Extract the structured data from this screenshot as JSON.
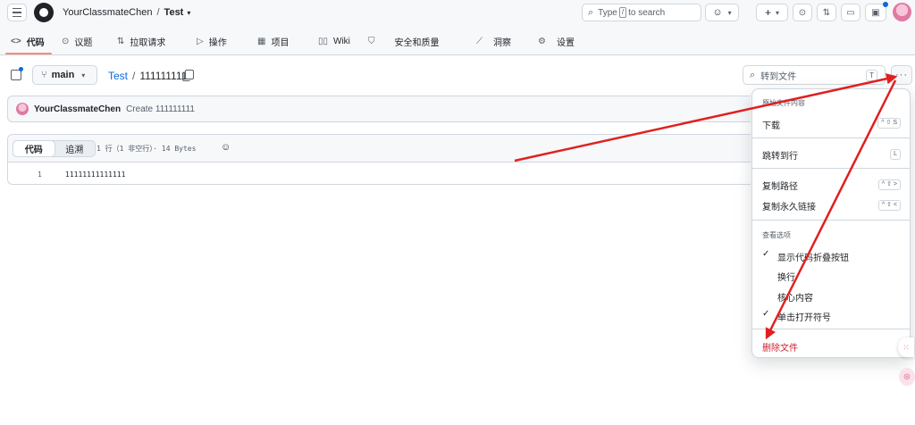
{
  "header": {
    "owner": "YourClassmateChen",
    "separator": "/",
    "repo": "Test",
    "search_prefix": "Type",
    "search_key": "/",
    "search_suffix": "to search",
    "plus": "+",
    "caret": "▾"
  },
  "tabs": [
    {
      "icon": "<>",
      "label": "代码"
    },
    {
      "icon": "⊙",
      "label": "议题"
    },
    {
      "icon": "⇅",
      "label": "拉取请求"
    },
    {
      "icon": "▷",
      "label": "操作"
    },
    {
      "icon": "▦",
      "label": "项目"
    },
    {
      "icon": "▯▯",
      "label": "Wiki"
    },
    {
      "icon": "⛉",
      "label": "安全和质量"
    },
    {
      "icon": "⟋",
      "label": "洞察"
    },
    {
      "icon": "⚙",
      "label": "设置"
    }
  ],
  "toolbar": {
    "branch": "main",
    "path_repo": "Test",
    "path_sep": "/",
    "file_name": "111111111",
    "go_to_file": "转到文件",
    "go_to_file_key": "T",
    "more": "···"
  },
  "commit": {
    "user": "YourClassmateChen",
    "message": "Create 111111111"
  },
  "file": {
    "tab_code": "代码",
    "tab_blame": "追溯",
    "info": "1 行（1 非空行）· 14 Bytes",
    "line_number": "1",
    "line_content": "11111111111111"
  },
  "menu": {
    "group_raw": "原始文件内容",
    "download": "下载",
    "download_key": "^ ⇧ S",
    "jump_line": "跳转到行",
    "jump_key": "L",
    "copy_path": "复制路径",
    "copy_path_key": "^ ⇧ >",
    "copy_permalink": "复制永久链接",
    "copy_permalink_key": "^ ⇧ <",
    "group_view": "查看选项",
    "show_fold": "显示代码折叠按钮",
    "wrap": "换行",
    "core": "核心内容",
    "open_symbol": "单击打开符号",
    "delete": "删除文件",
    "check": "✓"
  },
  "colors": {
    "accent": "#0969da",
    "danger": "#cf222e",
    "annotation_arrow": "#e02020"
  }
}
